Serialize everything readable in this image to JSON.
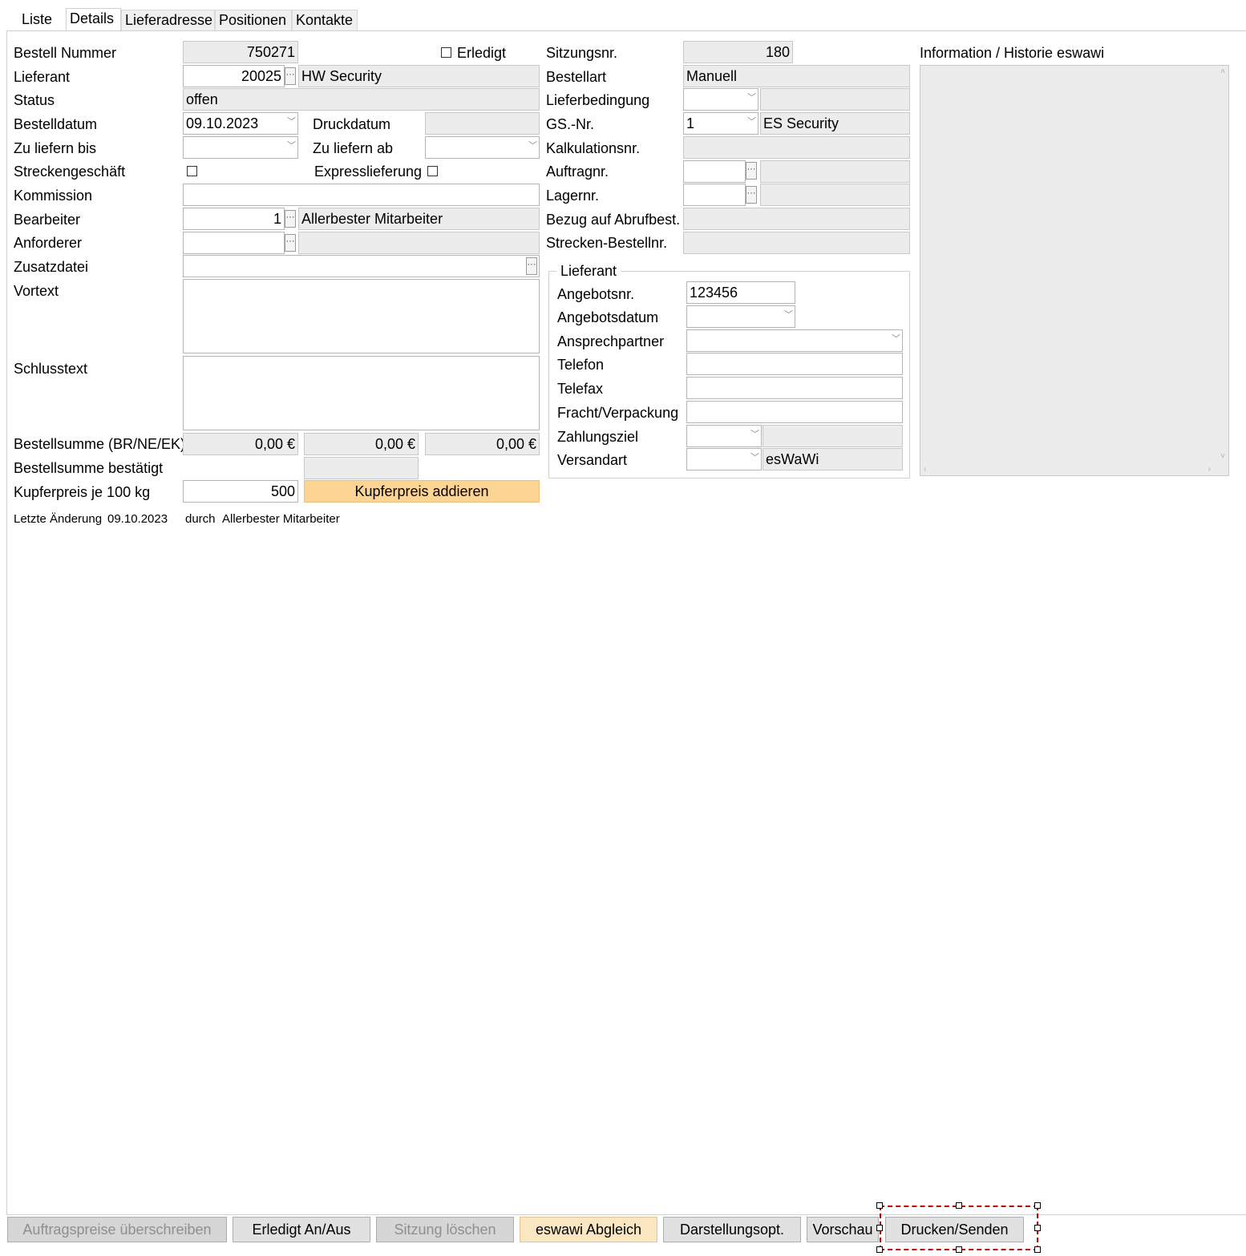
{
  "tabs": [
    "Liste",
    "Details",
    "Lieferadresse",
    "Positionen",
    "Kontakte"
  ],
  "labels": {
    "bestell_nummer": "Bestell Nummer",
    "lieferant": "Lieferant",
    "status": "Status",
    "bestelldatum": "Bestelldatum",
    "zu_liefern_bis": "Zu liefern bis",
    "streckengeschaeft": "Streckengeschäft",
    "kommission": "Kommission",
    "bearbeiter": "Bearbeiter",
    "anforderer": "Anforderer",
    "zusatzdatei": "Zusatzdatei",
    "vortext": "Vortext",
    "schlusstext": "Schlusstext",
    "bestellsumme": "Bestellsumme (BR/NE/EK)",
    "bestellsumme_bestaetigt": "Bestellsumme bestätigt",
    "kupferpreis": "Kupferpreis je 100 kg",
    "erledigt": "Erledigt",
    "druckdatum": "Druckdatum",
    "zu_liefern_ab": "Zu liefern ab",
    "expresslieferung": "Expresslieferung",
    "sitzungsnr": "Sitzungsnr.",
    "bestellart": "Bestellart",
    "lieferbedingung": "Lieferbedingung",
    "gs_nr": "GS.-Nr.",
    "kalkulationsnr": "Kalkulationsnr.",
    "auftragnr": "Auftragnr.",
    "lagernr": "Lagernr.",
    "bezug_abrufbest": "Bezug auf Abrufbest.",
    "strecken_bestellnr": "Strecken-Bestellnr.",
    "lieferant_group": "Lieferant",
    "angebotsnr": "Angebotsnr.",
    "angebotsdatum": "Angebotsdatum",
    "ansprechpartner": "Ansprechpartner",
    "telefon": "Telefon",
    "telefax": "Telefax",
    "fracht": "Fracht/Verpackung",
    "zahlungsziel": "Zahlungsziel",
    "versandart": "Versandart",
    "info_historie": "Information / Historie eswawi"
  },
  "values": {
    "bestell_nummer": "750271",
    "lieferant_nr": "20025",
    "lieferant_name": "HW Security",
    "status": "offen",
    "bestelldatum": "09.10.2023",
    "bearbeiter_nr": "1",
    "bearbeiter_name": "Allerbester Mitarbeiter",
    "summe_br": "0,00 €",
    "summe_ne": "0,00 €",
    "summe_ek": "0,00 €",
    "kupferpreis": "500",
    "sitzungsnr": "180",
    "bestellart": "Manuell",
    "gs_nr": "1",
    "gs_name": "ES Security",
    "angebotsnr": "123456",
    "versandart_name": "esWaWi"
  },
  "buttons": {
    "kupferpreis_addieren": "Kupferpreis addieren",
    "auftragspreise": "Auftragspreise überschreiben",
    "erledigt_an_aus": "Erledigt An/Aus",
    "sitzung_loeschen": "Sitzung löschen",
    "eswawi_abgleich": "eswawi Abgleich",
    "darstellungsopt": "Darstellungsopt.",
    "vorschau": "Vorschau",
    "drucken_senden": "Drucken/Senden"
  },
  "footer": {
    "letzte_aenderung_label": "Letzte Änderung",
    "letzte_aenderung_datum": "09.10.2023",
    "durch_label": "durch",
    "durch_name": "Allerbester Mitarbeiter"
  },
  "icons": {
    "dots": "ellipsis-icon",
    "combo": "chevron-down-icon"
  },
  "colors": {
    "accent_orange": "#fcd595",
    "selection_red": "#c00000"
  }
}
